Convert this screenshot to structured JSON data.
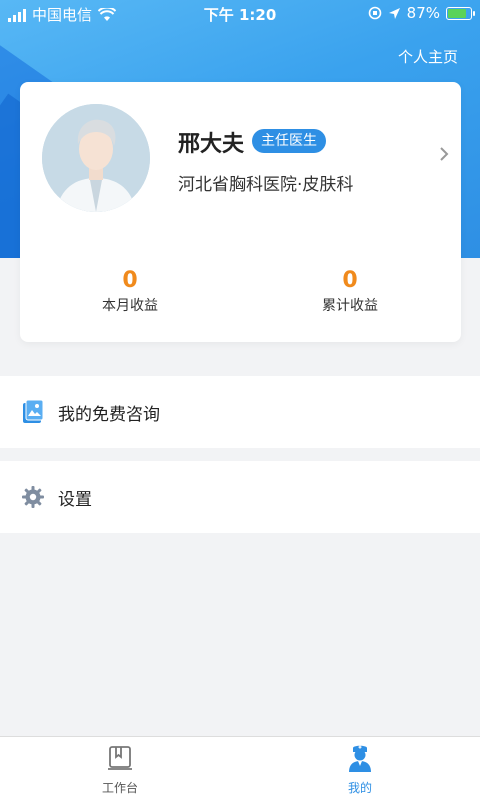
{
  "status_bar": {
    "carrier": "中国电信",
    "time": "下午 1:20",
    "battery_percent": "87%",
    "signal_icon": "signal-icon",
    "wifi_icon": "wifi-icon",
    "battery_icon": "battery-charging-icon"
  },
  "header": {
    "homepage_link": "个人主页"
  },
  "profile": {
    "name": "邢大夫",
    "title": "主任医生",
    "hospital": "河北省胸科医院·皮肤科",
    "arrow_icon": "chevron-right-icon"
  },
  "stats": {
    "month_value": "0",
    "month_label": "本月收益",
    "total_value": "0",
    "total_label": "累计收益"
  },
  "menu": {
    "consult_label": "我的免费咨询",
    "settings_label": "设置"
  },
  "tabs": {
    "workbench_label": "工作台",
    "mine_label": "我的"
  },
  "colors": {
    "accent": "#2e8fe4",
    "stat_value": "#f08a1c",
    "active_tab": "#2e8fe4"
  }
}
